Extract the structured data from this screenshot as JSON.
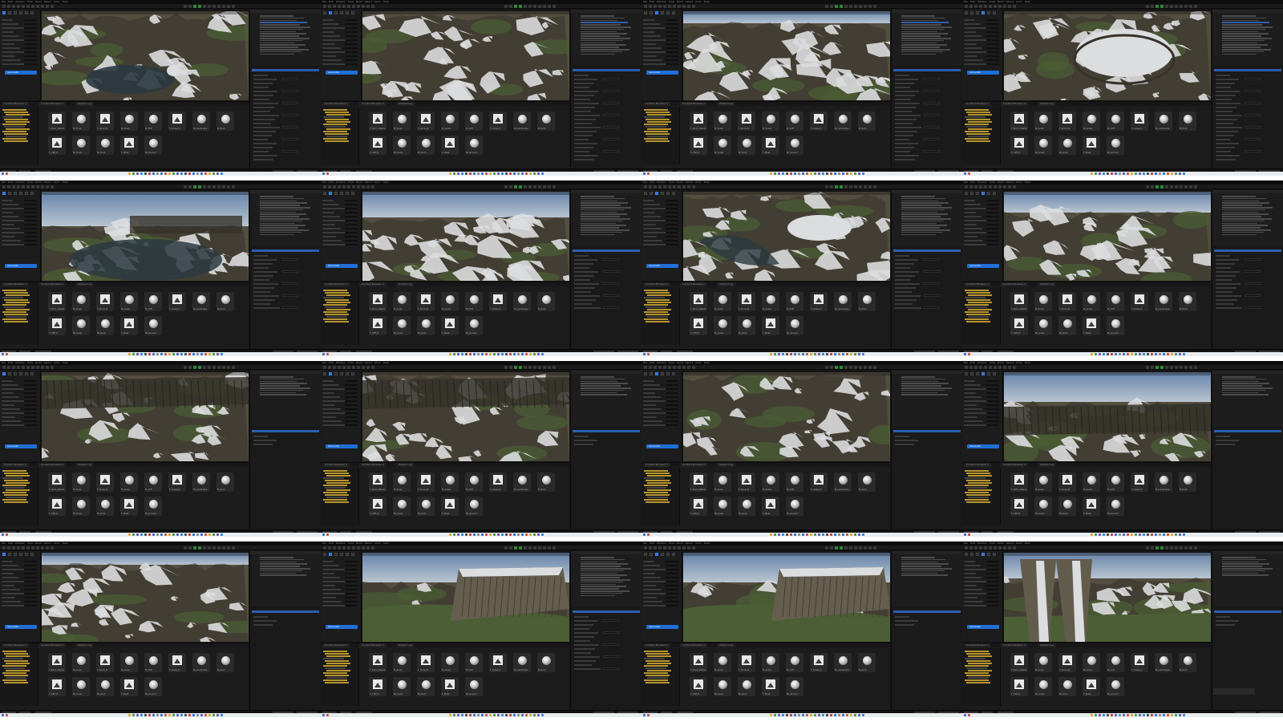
{
  "menu": {
    "items": [
      "File",
      "Edit",
      "Window",
      "Tools",
      "Build",
      "Select",
      "Actor",
      "Help"
    ]
  },
  "left_panel": {
    "primary_button": "Generate"
  },
  "content_browser": {
    "tabs": [
      "Content Browser 1",
      "Content Browser 2",
      "Output Log"
    ],
    "assets": [
      {
        "kind": "texture",
        "label": "T_Rock_Albedo"
      },
      {
        "kind": "sphere",
        "label": "M_Snow"
      },
      {
        "kind": "texture",
        "label": "T_Snow_N"
      },
      {
        "kind": "sphere",
        "label": "M_Grass"
      },
      {
        "kind": "sphere",
        "label": "M_Cliff"
      },
      {
        "kind": "texture",
        "label": "T_Grass_D"
      },
      {
        "kind": "sphere",
        "label": "M_Landscape"
      },
      {
        "kind": "sphere",
        "label": "M_Rock"
      },
      {
        "kind": "texture",
        "label": "T_Cliff_D"
      },
      {
        "kind": "sphere",
        "label": "MI_Snow"
      },
      {
        "kind": "sphere",
        "label": "MI_Rock"
      },
      {
        "kind": "texture",
        "label": "T_Mask"
      },
      {
        "kind": "sphere",
        "label": "MI_Ground"
      }
    ]
  },
  "viewport_colors": {
    "sky_top": "#6f8fb8",
    "sky_bottom": "#c9d6e3",
    "snow": "#eef0f2",
    "rock": "#5b5546",
    "grass": "#52663a",
    "water": "#2f3e46",
    "shadow": "#3a372e"
  },
  "frames": [
    {
      "view": "aerial",
      "feature": "lake",
      "snow": 0.55,
      "sky": 0.0,
      "details_mode": "full"
    },
    {
      "view": "aerial",
      "feature": "valley",
      "snow": 0.6,
      "sky": 0.0,
      "details_mode": "full"
    },
    {
      "view": "aerial",
      "feature": "ridges",
      "snow": 0.65,
      "sky": 0.1,
      "details_mode": "full"
    },
    {
      "view": "aerial",
      "feature": "plateau",
      "snow": 0.6,
      "sky": 0.0,
      "details_mode": "full"
    },
    {
      "view": "low",
      "feature": "crater",
      "snow": 0.45,
      "sky": 0.35,
      "details_mode": "partial"
    },
    {
      "view": "low",
      "feature": "slope",
      "snow": 0.8,
      "sky": 0.25,
      "details_mode": "partial"
    },
    {
      "view": "aerial",
      "feature": "canyon",
      "snow": 0.6,
      "sky": 0.0,
      "details_mode": "partial"
    },
    {
      "view": "aerial",
      "feature": "ridges",
      "snow": 0.55,
      "sky": 0.2,
      "details_mode": "partial"
    },
    {
      "view": "close",
      "feature": "cliffs",
      "snow": 0.6,
      "sky": 0.0,
      "details_mode": "empty"
    },
    {
      "view": "close",
      "feature": "cliffs",
      "snow": 0.65,
      "sky": 0.0,
      "details_mode": "empty"
    },
    {
      "view": "close",
      "feature": "slope",
      "snow": 0.5,
      "sky": 0.0,
      "details_mode": "empty"
    },
    {
      "view": "low",
      "feature": "cliffface",
      "snow": 0.35,
      "sky": 0.3,
      "details_mode": "empty"
    },
    {
      "view": "close",
      "feature": "slope",
      "snow": 0.55,
      "sky": 0.1,
      "details_mode": "empty"
    },
    {
      "view": "low",
      "feature": "mesa",
      "snow": 0.15,
      "sky": 0.3,
      "details_mode": "partial"
    },
    {
      "view": "low",
      "feature": "mesa",
      "snow": 0.2,
      "sky": 0.3,
      "details_mode": "empty"
    },
    {
      "view": "low",
      "feature": "pillars",
      "snow": 0.35,
      "sky": 0.25,
      "details_mode": "empty"
    }
  ]
}
